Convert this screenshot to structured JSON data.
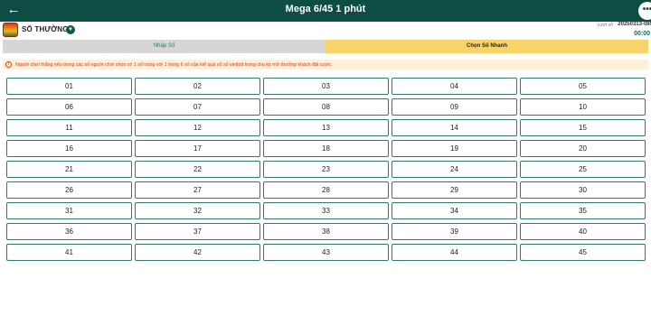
{
  "header": {
    "title": "Mega 6/45 1 phút",
    "back_icon": "arrow-left-icon",
    "more_label": "•••"
  },
  "game": {
    "type_label": "SỐ THƯỜNG",
    "dropdown_icon": "chevron-down-icon",
    "round_label": "Lượt xổ",
    "round_id": "20250313-089",
    "countdown": "00:00"
  },
  "tabs": [
    {
      "label": "Nhập Số",
      "active": false
    },
    {
      "label": "Chọn Số Nhanh",
      "active": true
    }
  ],
  "notice": {
    "icon": "alert-circle-icon",
    "text": "Người chơi thắng nếu trong các số người chơi chọn có 1 số trùng với 1 trong 6 số của kết quả xổ số vietlott trong chu kỳ mở thưởng khách đặt cược."
  },
  "numbers": [
    "01",
    "02",
    "03",
    "04",
    "05",
    "06",
    "07",
    "08",
    "09",
    "10",
    "11",
    "12",
    "13",
    "14",
    "15",
    "16",
    "17",
    "18",
    "19",
    "20",
    "21",
    "22",
    "23",
    "24",
    "25",
    "26",
    "27",
    "28",
    "29",
    "30",
    "31",
    "32",
    "33",
    "34",
    "35",
    "36",
    "37",
    "38",
    "39",
    "40",
    "41",
    "42",
    "43",
    "44",
    "45"
  ],
  "colors": {
    "header_bg": "#0d4d43",
    "tab_active_bg": "#f8d36a",
    "tab_inactive_bg": "#d6d6d6",
    "button_border": "#2f7a6c",
    "notice_text": "#d0391c"
  }
}
